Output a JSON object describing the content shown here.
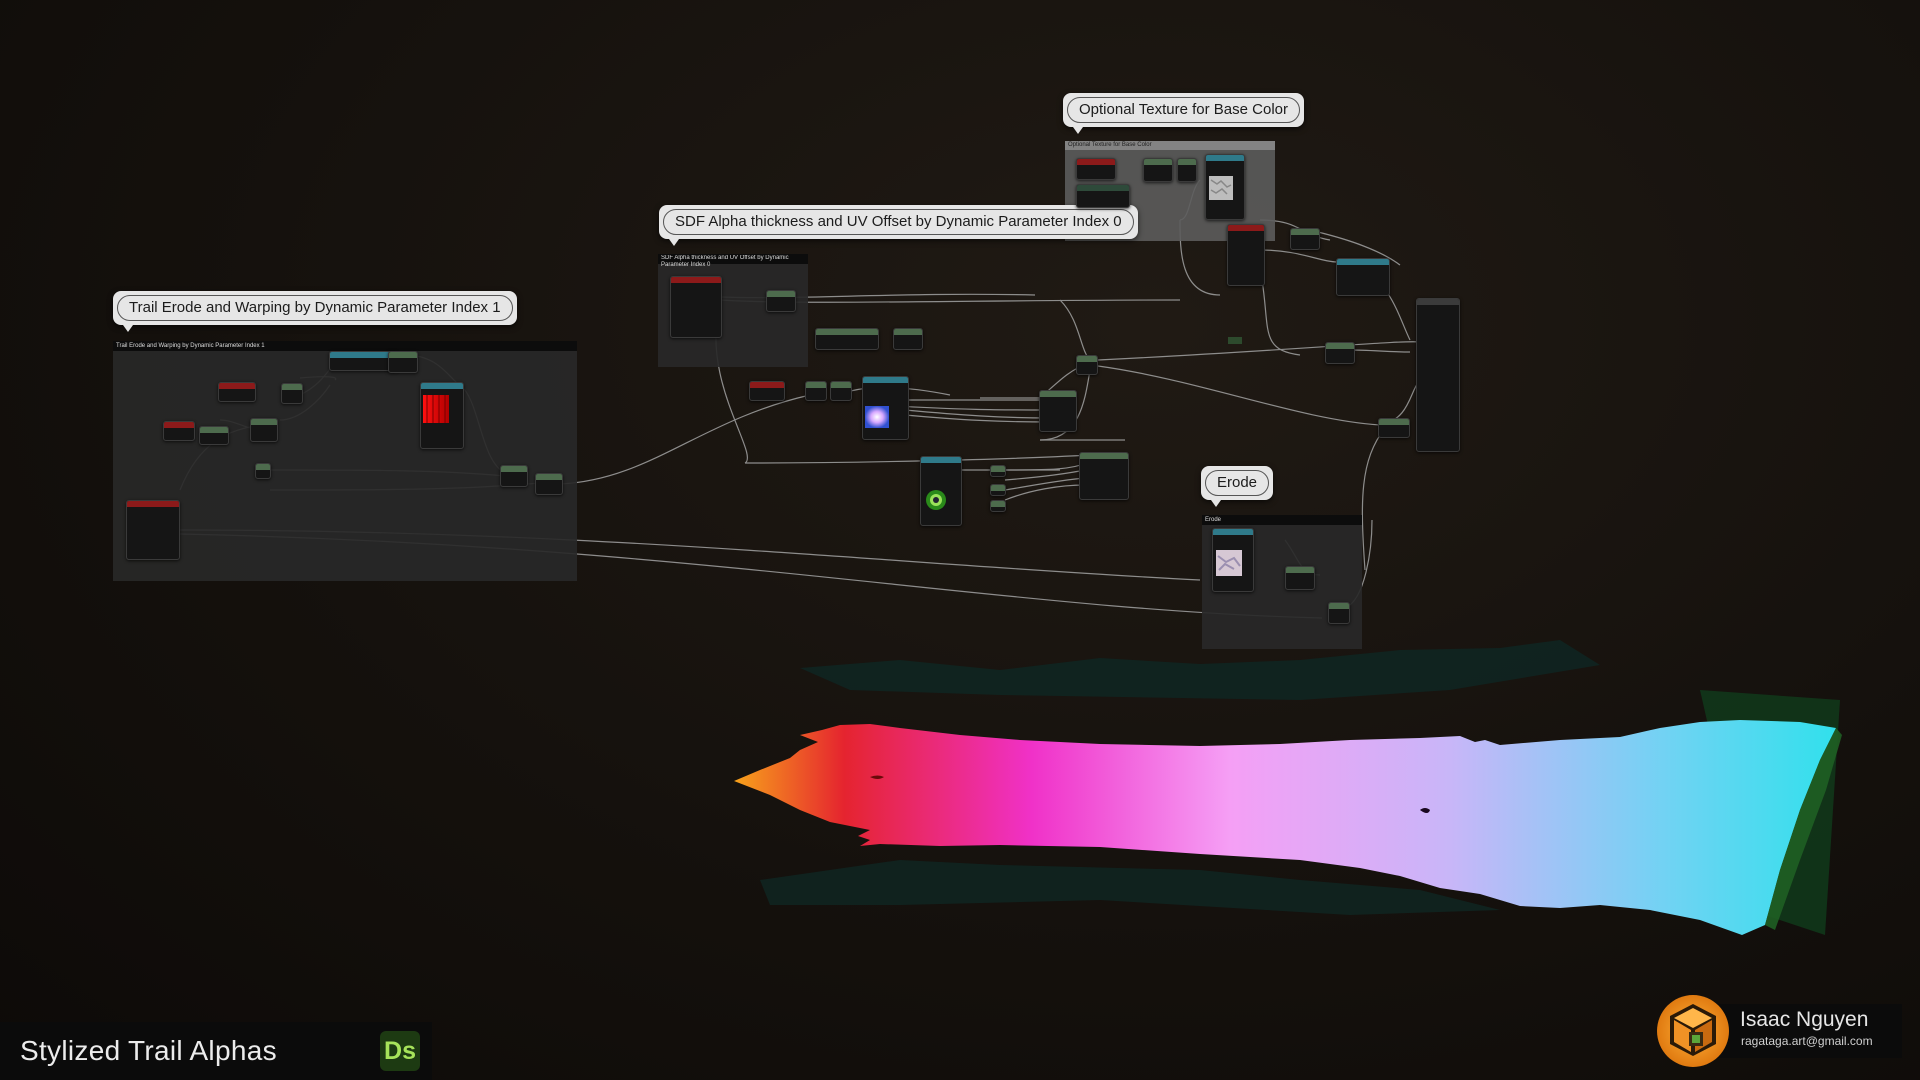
{
  "comments": {
    "trail_erode": "Trail Erode and Warping by Dynamic Parameter Index 1",
    "sdf_alpha": "SDF Alpha thickness and UV Offset by Dynamic Parameter Index 0",
    "optional_texture": "Optional Texture for Base Color",
    "erode": "Erode"
  },
  "comment_box_titles": {
    "trail_erode": "Trail Erode and Warping by Dynamic Parameter Index 1",
    "sdf_alpha": "SDF Alpha thickness and UV Offset by Dynamic Parameter Index 0",
    "optional_texture": "Optional Texture for Base Color",
    "erode": "Erode"
  },
  "footer": {
    "title": "Stylized Trail Alphas",
    "badge": "Ds"
  },
  "signature": {
    "name": "Isaac Nguyen",
    "email": "ragataga.art@gmail.com"
  },
  "colors": {
    "background": "#17120e",
    "wire": "#9a9a9a",
    "node_header_red": "#8c1a1a",
    "node_header_green": "#4d6b4d",
    "node_header_teal": "#2f7a8a",
    "trail_gradient": [
      "#f7a21b",
      "#e5242f",
      "#f031c8",
      "#f59ff5",
      "#c6b2f7",
      "#31e0ec"
    ],
    "badge_green": "#a6e25a"
  }
}
